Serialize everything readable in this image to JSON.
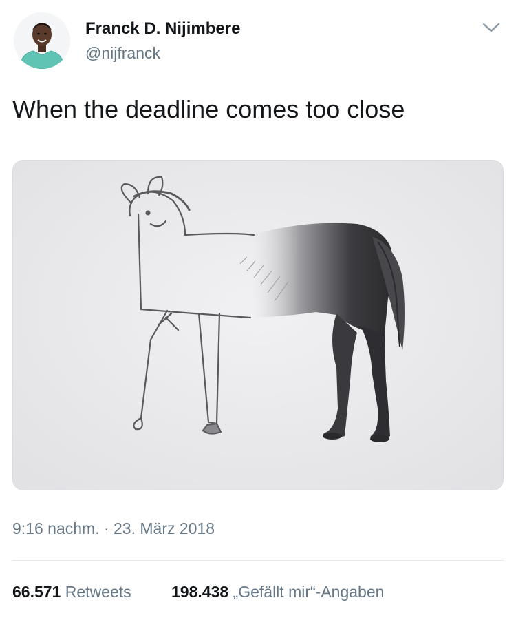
{
  "author": {
    "name": "Franck D. Nijimbere",
    "handle": "@nijfranck",
    "avatar_icon": "profile-photo"
  },
  "tweet": {
    "text": "When the deadline comes too close",
    "media": {
      "icon": "horse-drawing-image"
    }
  },
  "meta": {
    "timestamp": "9:16 nachm. · 23. März 2018"
  },
  "stats": {
    "retweets_count": "66.571",
    "retweets_label": "Retweets",
    "likes_count": "198.438",
    "likes_label": "„Gefällt mir“-Angaben"
  },
  "colors": {
    "text_primary": "#14171a",
    "text_secondary": "#657786",
    "divider": "#e1e8ed",
    "media_border": "#d6dbdf"
  }
}
